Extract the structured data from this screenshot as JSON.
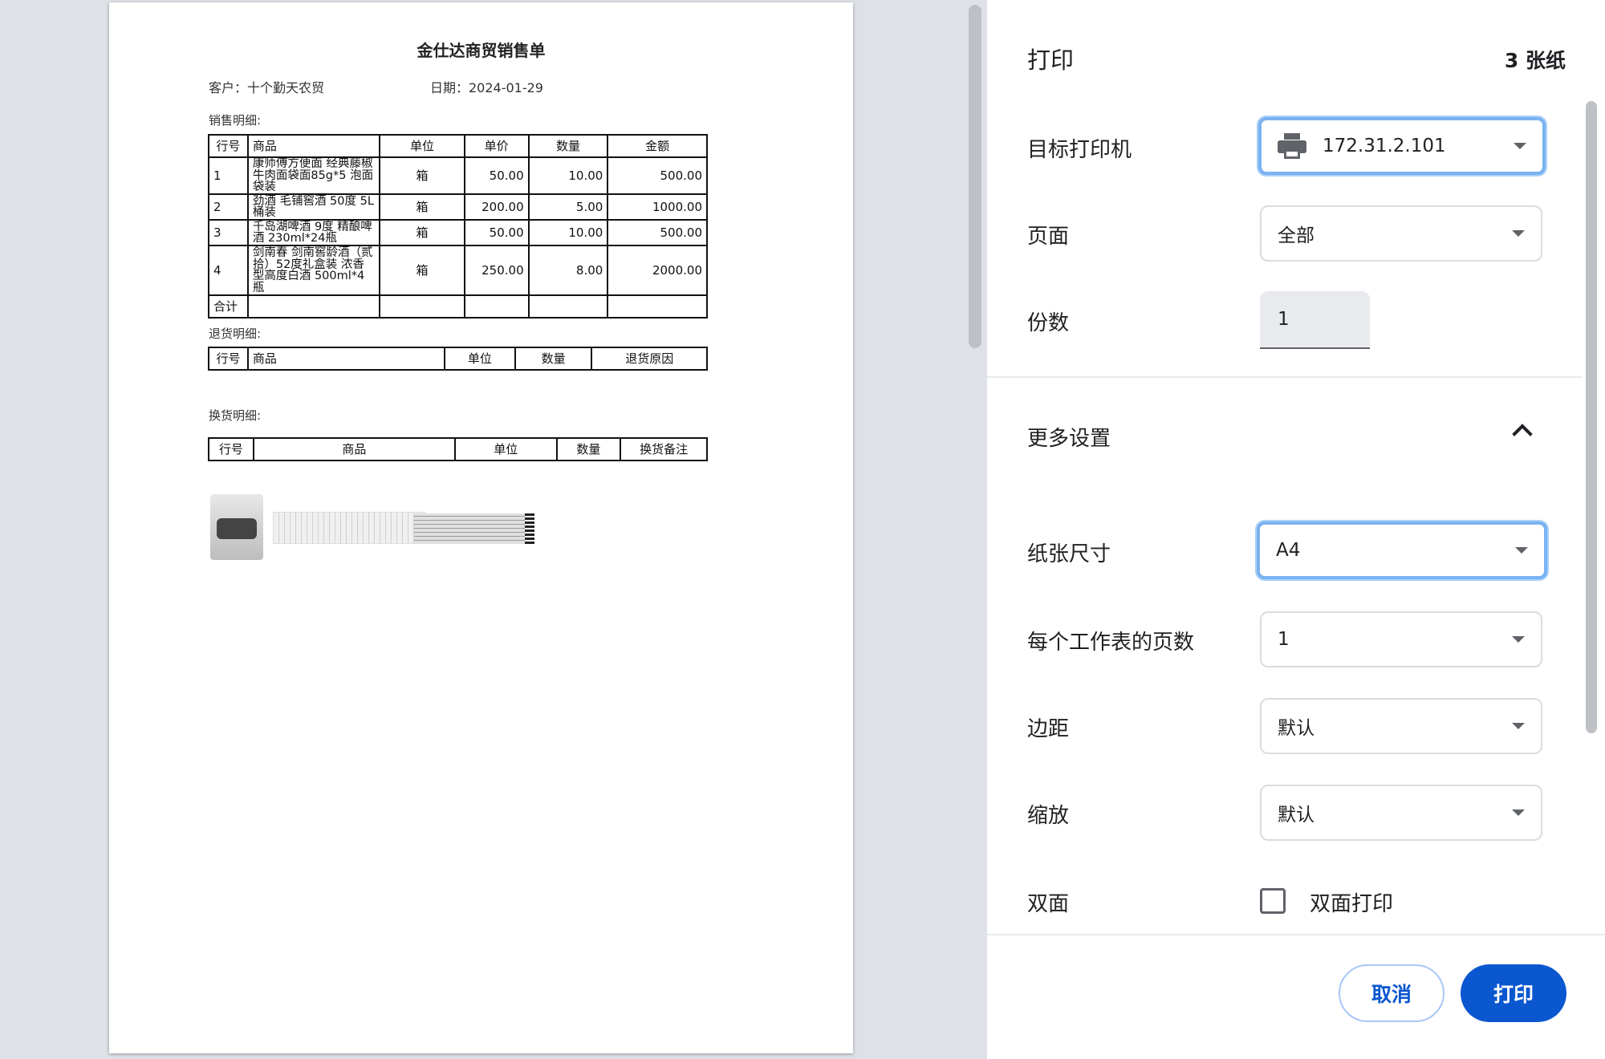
{
  "document": {
    "title": "金仕达商贸销售单",
    "customer": "客户：十个勤天农贸",
    "date": "日期：2024-01-29",
    "sales_label": "销售明细:",
    "sales_headers": [
      "行号",
      "商品",
      "单位",
      "单价",
      "数量",
      "金额"
    ],
    "sales_rows": [
      [
        "1",
        "康师傅方便面 经典藤椒牛肉面袋面85g*5 泡面袋装",
        "箱",
        "50.00",
        "10.00",
        "500.00"
      ],
      [
        "2",
        "劲酒 毛铺窖酒 50度 5L 桶装",
        "箱",
        "200.00",
        "5.00",
        "1000.00"
      ],
      [
        "3",
        "千岛湖啤酒 9度 精酿啤酒 230ml*24瓶",
        "箱",
        "50.00",
        "10.00",
        "500.00"
      ],
      [
        "4",
        "剑南春 剑南窖龄酒（贰拾）52度礼盒装 浓香型高度白酒 500ml*4瓶",
        "箱",
        "250.00",
        "8.00",
        "2000.00"
      ]
    ],
    "sales_total_label": "合计",
    "return_label": "退货明细:",
    "return_headers": [
      "行号",
      "商品",
      "单位",
      "数量",
      "退货原因"
    ],
    "exchange_label": "换货明细:",
    "exchange_headers": [
      "行号",
      "商品",
      "单位",
      "数量",
      "换货备注"
    ]
  },
  "panel": {
    "title": "打印",
    "sheet_count": "3 张纸",
    "destination_label": "目标打印机",
    "destination_value": "172.31.2.101",
    "pages_label": "页面",
    "pages_value": "全部",
    "copies_label": "份数",
    "copies_value": "1",
    "more_settings_label": "更多设置",
    "paper_size_label": "纸张尺寸",
    "paper_size_value": "A4",
    "pages_per_sheet_label": "每个工作表的页数",
    "pages_per_sheet_value": "1",
    "margins_label": "边距",
    "margins_value": "默认",
    "scale_label": "缩放",
    "scale_value": "默认",
    "duplex_label": "双面",
    "duplex_option": "双面打印",
    "duplex_checked": false
  },
  "footer": {
    "cancel_label": "取消",
    "print_label": "打印"
  },
  "colors": {
    "primary": "#0b57d0",
    "focus_ring": "#7ab2f0",
    "background": "#dee1e6"
  }
}
